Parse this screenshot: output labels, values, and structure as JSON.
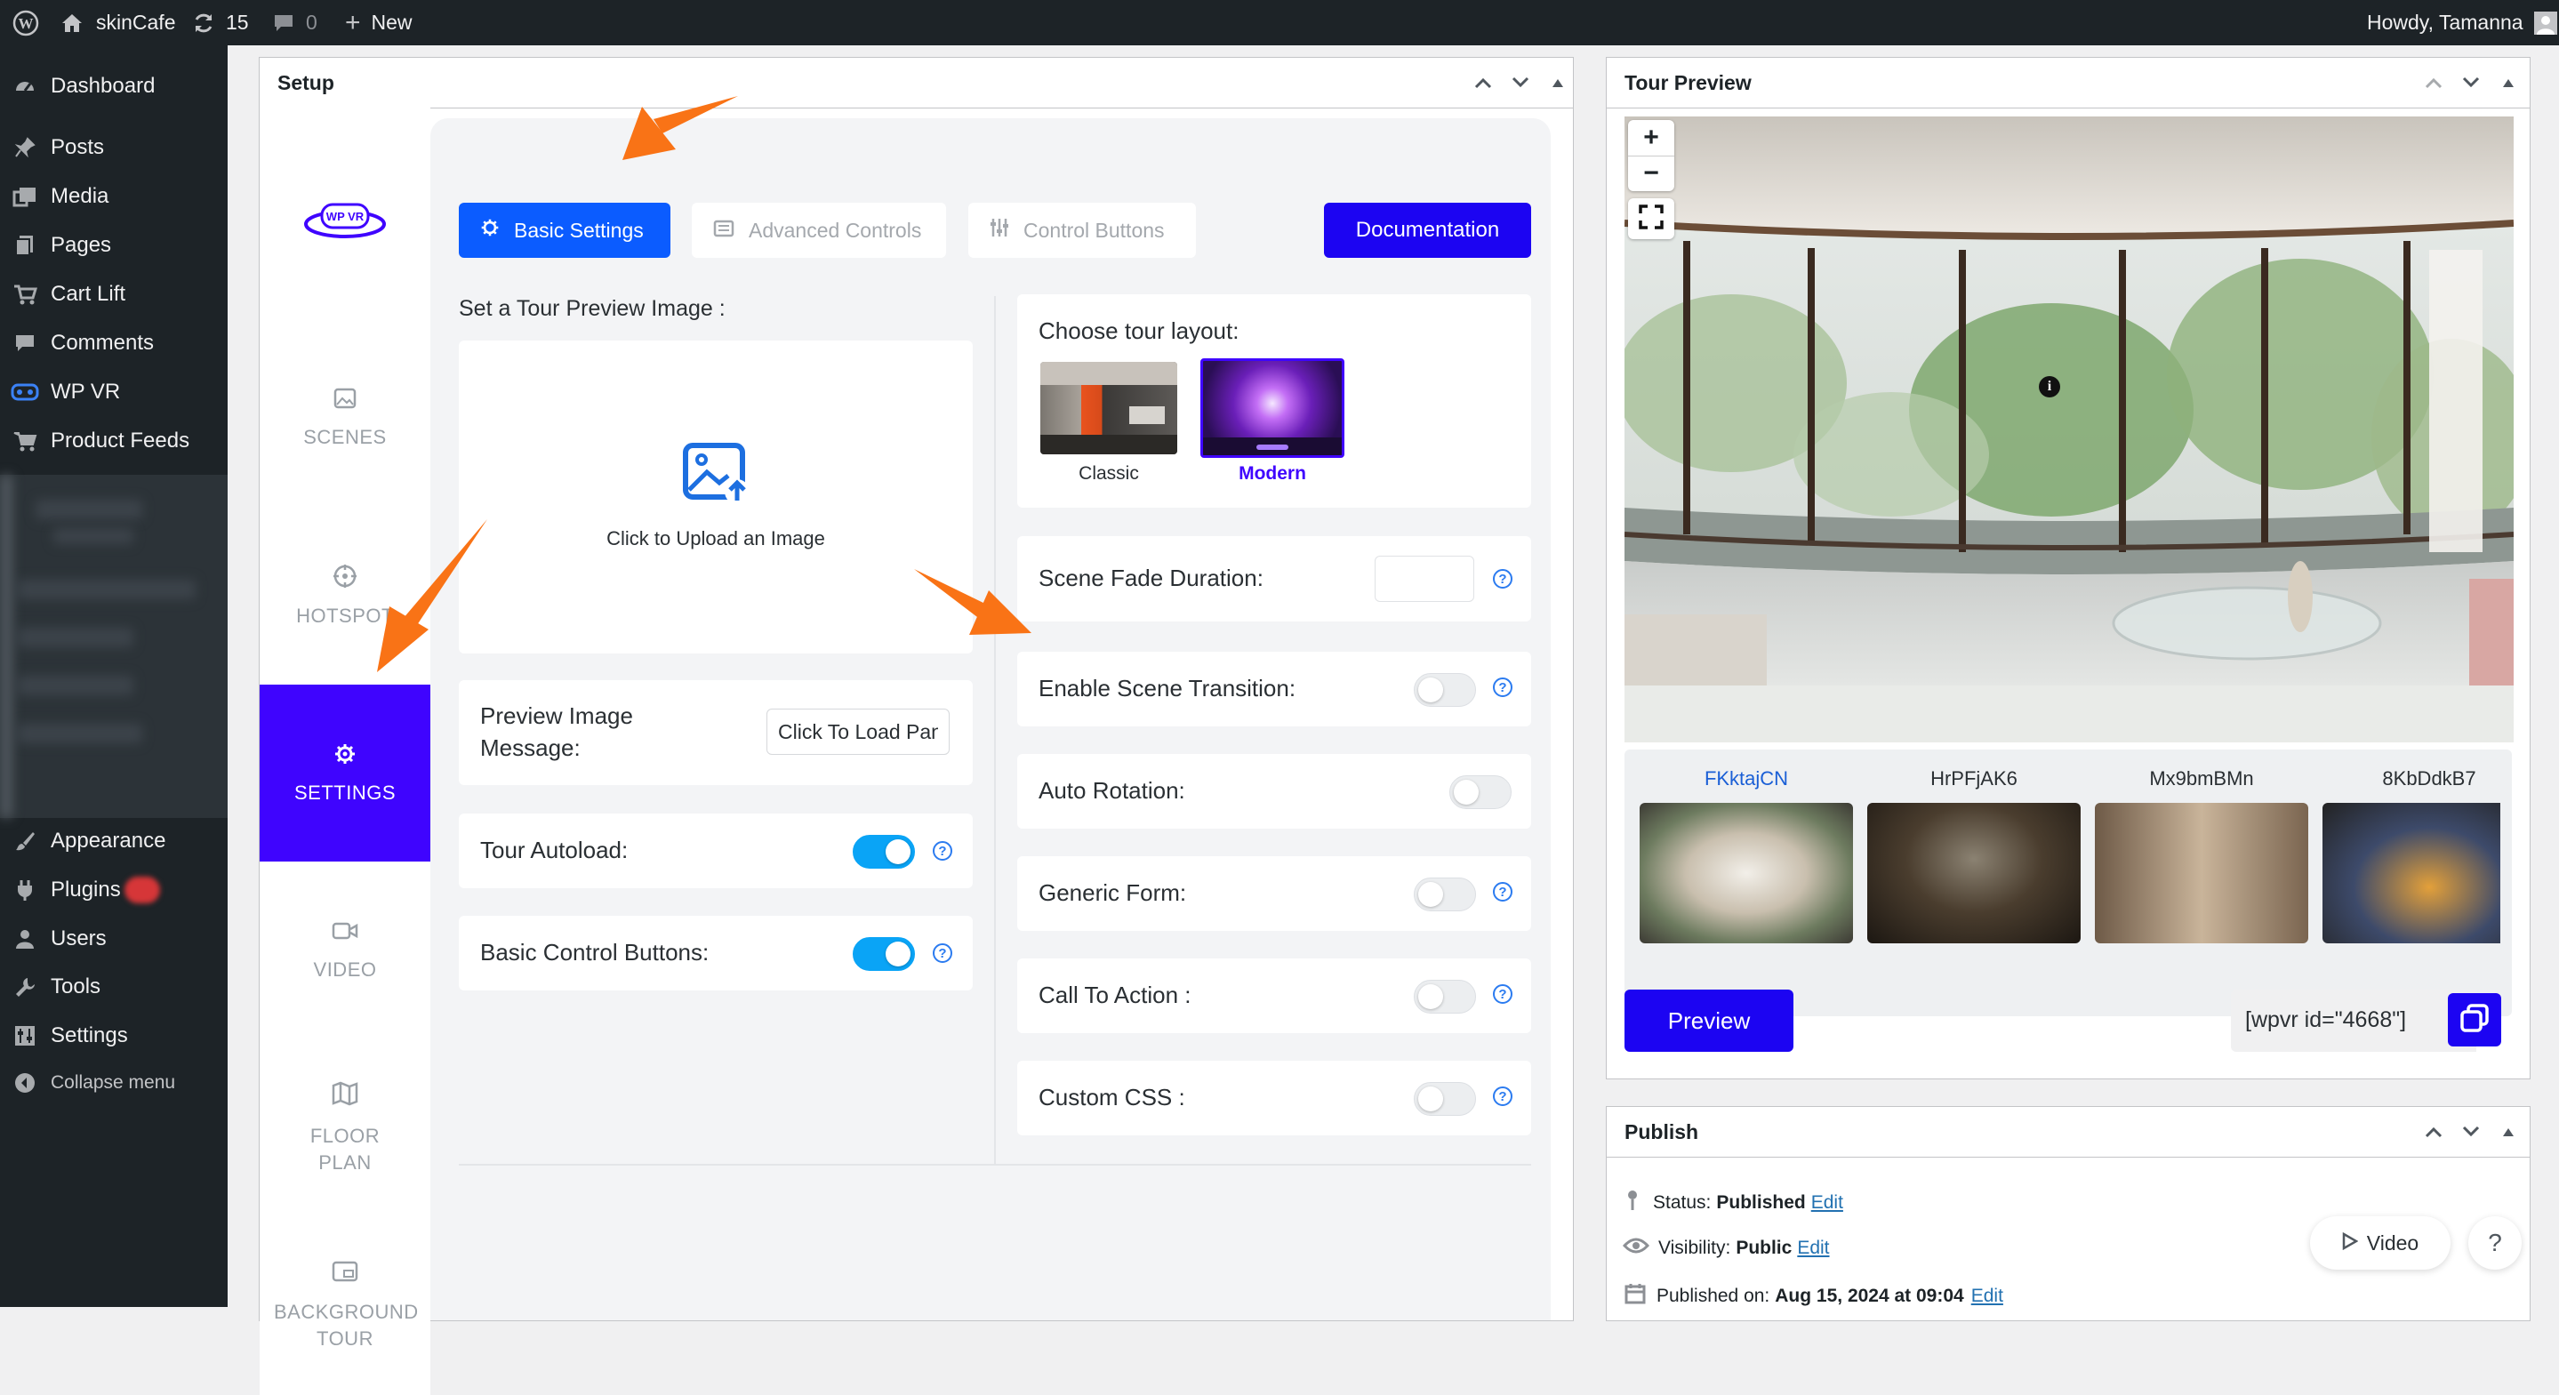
{
  "adminbar": {
    "site_name": "skinCafe",
    "updates_count": "15",
    "comments_count": "0",
    "new_label": "New",
    "howdy": "Howdy, Tamanna"
  },
  "sidebar": {
    "items": [
      {
        "label": "Dashboard",
        "icon": "dashboard-icon"
      },
      {
        "label": "Posts",
        "icon": "pin-icon"
      },
      {
        "label": "Media",
        "icon": "media-icon"
      },
      {
        "label": "Pages",
        "icon": "pages-icon"
      },
      {
        "label": "Cart Lift",
        "icon": "cart-icon"
      },
      {
        "label": "Comments",
        "icon": "comment-icon"
      },
      {
        "label": "WP VR",
        "icon": "vr-icon"
      },
      {
        "label": "Product Feeds",
        "icon": "cart-icon"
      },
      {
        "label": "Appearance",
        "icon": "brush-icon"
      },
      {
        "label": "Plugins",
        "icon": "plug-icon"
      },
      {
        "label": "Users",
        "icon": "user-icon"
      },
      {
        "label": "Tools",
        "icon": "wrench-icon"
      },
      {
        "label": "Settings",
        "icon": "settings-icon"
      },
      {
        "label": "Collapse menu",
        "icon": "collapse-icon"
      }
    ]
  },
  "setup": {
    "title": "Setup",
    "logo_text": "WP VR",
    "side_tabs": [
      {
        "label": "SCENES",
        "icon": "image-icon"
      },
      {
        "label": "HOTSPOT",
        "icon": "target-icon"
      },
      {
        "label": "SETTINGS",
        "icon": "gear-icon"
      },
      {
        "label": "VIDEO",
        "icon": "video-icon"
      },
      {
        "label": "FLOOR PLAN",
        "icon": "map-icon"
      },
      {
        "label": "BACKGROUND TOUR",
        "icon": "screen-icon"
      }
    ],
    "top_tabs": {
      "basic": "Basic Settings",
      "advanced": "Advanced Controls",
      "control": "Control Buttons",
      "documentation": "Documentation"
    },
    "preview_image_title": "Set a Tour Preview Image :",
    "upload_text": "Click to Upload an Image",
    "preview_message_label": "Preview Image Message:",
    "preview_message_value": "Click To Load Pan",
    "tour_autoload": "Tour Autoload:",
    "basic_control_buttons": "Basic Control Buttons:",
    "layout_title": "Choose tour layout:",
    "layout_classic": "Classic",
    "layout_modern": "Modern",
    "scene_fade_duration": "Scene Fade Duration:",
    "scene_fade_value": "",
    "enable_scene_transition": "Enable Scene Transition:",
    "auto_rotation": "Auto Rotation:",
    "generic_form": "Generic Form:",
    "call_to_action": "Call To Action :",
    "custom_css": "Custom CSS :",
    "toggles": {
      "tour_autoload": true,
      "basic_control_buttons": true,
      "enable_scene_transition": false,
      "auto_rotation": false,
      "generic_form": false,
      "call_to_action": false,
      "custom_css": false
    }
  },
  "preview": {
    "title": "Tour Preview",
    "zoom_in": "+",
    "zoom_out": "−",
    "info": "i",
    "scenes": [
      "FKktajCN",
      "HrPFjAK6",
      "Mx9bmBMn",
      "8KbDdkB7"
    ],
    "active_scene": "FKktajCN",
    "preview_button": "Preview",
    "shortcode": "[wpvr id=\"4668\"]"
  },
  "publish": {
    "title": "Publish",
    "status_label": "Status:",
    "status_value": "Published",
    "visibility_label": "Visibility:",
    "visibility_value": "Public",
    "published_label": "Published on:",
    "published_value": "Aug 15, 2024 at 09:04",
    "edit": "Edit",
    "video_button": "Video",
    "help_button": "?"
  },
  "colors": {
    "accent": "#3f04fe",
    "basic_tab": "#0b5cff",
    "toggle_on": "#0aa4f6",
    "arrow": "#f97316",
    "admin_dark": "#1d2327"
  }
}
